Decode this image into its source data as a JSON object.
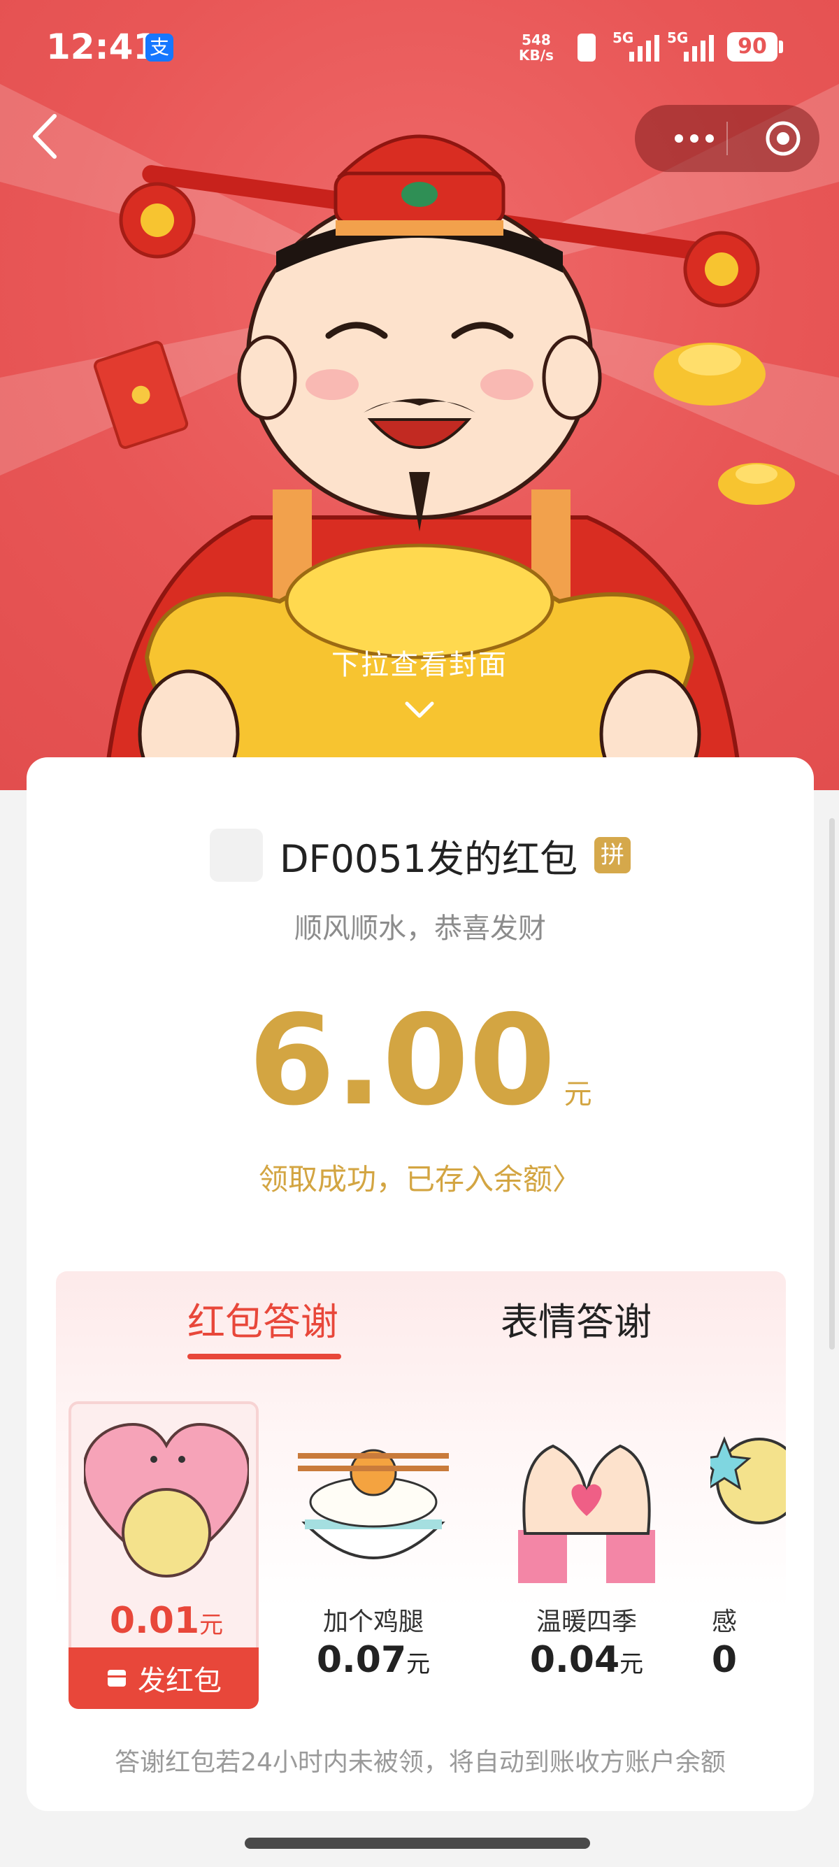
{
  "status_bar": {
    "time": "12:41",
    "pay_badge": "支",
    "net_speed_value": "548",
    "net_speed_unit": "KB/s",
    "sim1_label": "5G",
    "sim2_label": "5G",
    "battery": "90"
  },
  "hero": {
    "pull_hint": "下拉查看封面"
  },
  "card": {
    "sender_name": "DF0051发的红包",
    "badge": "拼",
    "greeting": "顺风顺水，恭喜发财",
    "amount": "6.00",
    "amount_unit": "元",
    "received_text": "领取成功，已存入余额",
    "received_arrow": "〉"
  },
  "thanks": {
    "tabs": [
      {
        "label": "红包答谢",
        "active": true
      },
      {
        "label": "表情答谢",
        "active": false
      }
    ],
    "items": [
      {
        "name": "",
        "price": "0.01",
        "unit": "元",
        "selected": true,
        "button": "发红包"
      },
      {
        "name": "加个鸡腿",
        "price": "0.07",
        "unit": "元"
      },
      {
        "name": "温暖四季",
        "price": "0.04",
        "unit": "元"
      },
      {
        "name": "感",
        "price": "0",
        "unit": ""
      }
    ],
    "footnote": "答谢红包若24小时内未被领，将自动到账收方账户余额"
  },
  "colors": {
    "header_red": "#e85656",
    "gold": "#d3a542",
    "accent_red": "#e8473a"
  },
  "icons": [
    "back-icon",
    "more-icon",
    "target-icon",
    "chevron-down-icon",
    "gift-icon"
  ]
}
